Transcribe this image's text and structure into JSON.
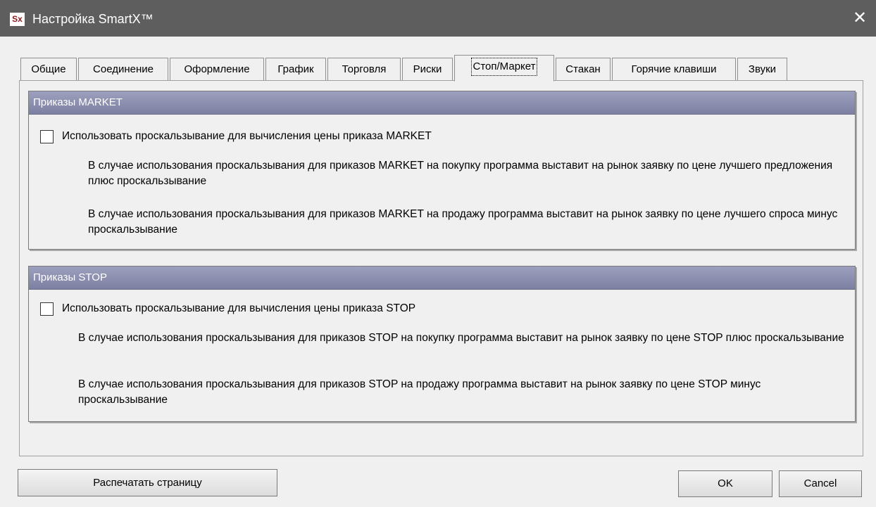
{
  "window": {
    "title": "Настройка SmartX™",
    "app_icon_text": "Sx",
    "close_glyph": "✕"
  },
  "tabs": [
    {
      "label": "Общие"
    },
    {
      "label": "Соединение"
    },
    {
      "label": "Оформление"
    },
    {
      "label": "График"
    },
    {
      "label": "Торговля"
    },
    {
      "label": "Риски"
    },
    {
      "label": "Стоп/Маркет",
      "active": true
    },
    {
      "label": "Стакан"
    },
    {
      "label": "Горячие клавиши"
    },
    {
      "label": "Звуки"
    }
  ],
  "market_group": {
    "title": "Приказы MARKET",
    "checkbox_label": "Использовать проскальзывание для вычисления цены приказа MARKET",
    "checked": false,
    "desc_buy": "В случае использования проскальзывания для приказов MARKET на покупку программа выставит на рынок заявку по цене лучшего предложения плюс проскальзывание",
    "desc_sell": "В случае использования проскальзывания для приказов MARKET на продажу программа выставит на рынок заявку по цене лучшего спроса минус проскальзывание"
  },
  "stop_group": {
    "title": "Приказы STOP",
    "checkbox_label": "Использовать проскальзывание для вычисления цены приказа STOP",
    "checked": false,
    "desc_buy": "В случае использования проскальзывания для приказов STOP на покупку программа выставит на рынок заявку по цене STOP плюс проскальзывание",
    "desc_sell": "В случае использования проскальзывания для приказов STOP на продажу программа выставит на рынок заявку по цене STOP минус проскальзывание"
  },
  "buttons": {
    "print": "Распечатать страницу",
    "ok": "OK",
    "cancel": "Cancel"
  }
}
